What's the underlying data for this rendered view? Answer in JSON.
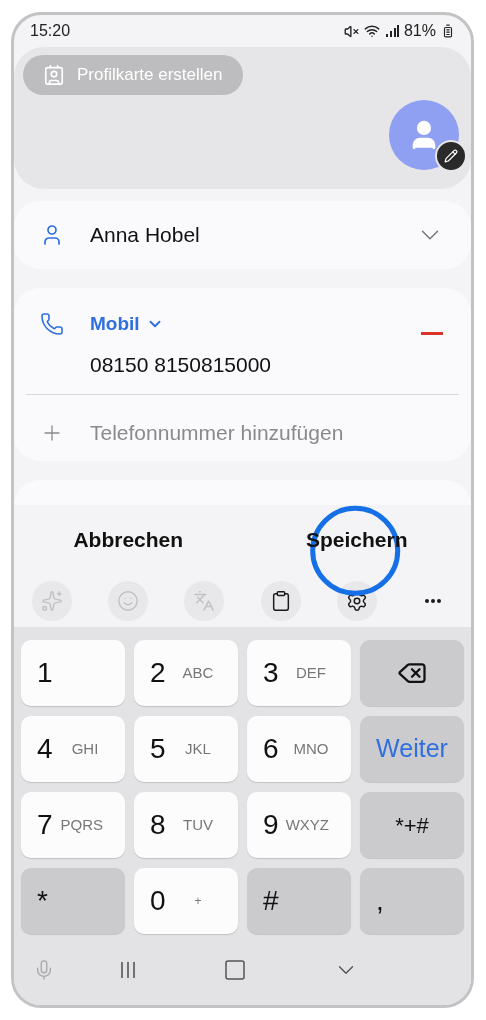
{
  "status_bar": {
    "time": "15:20",
    "battery": "81%"
  },
  "header": {
    "profile_card_button": "Profilkarte erstellen"
  },
  "name_field": {
    "value": "Anna Hobel",
    "expanded": false
  },
  "phone": {
    "type_label": "Mobil",
    "number": "08150 8150815000",
    "add_label": "Telefonnummer hinzufügen"
  },
  "actions": [
    {
      "label": "Abbrechen"
    },
    {
      "label": "Speichern",
      "highlighted": true
    }
  ],
  "toolbar": [
    {
      "kind": "sparkle",
      "disabled": true
    },
    {
      "kind": "emoji",
      "disabled": true
    },
    {
      "kind": "translate",
      "disabled": true
    },
    {
      "kind": "clipboard",
      "disabled": false
    },
    {
      "kind": "settings",
      "disabled": false
    },
    {
      "kind": "more",
      "disabled": false
    }
  ],
  "keyboard": [
    [
      {
        "kind": "digit",
        "label": "1"
      },
      {
        "kind": "digit",
        "label": "2",
        "sub": "ABC"
      },
      {
        "kind": "digit",
        "label": "3",
        "sub": "DEF"
      },
      {
        "kind": "backspace"
      }
    ],
    [
      {
        "kind": "digit",
        "label": "4",
        "sub": "GHI"
      },
      {
        "kind": "digit",
        "label": "5",
        "sub": "JKL"
      },
      {
        "kind": "digit",
        "label": "6",
        "sub": "MNO"
      },
      {
        "kind": "action",
        "label": "Weiter"
      }
    ],
    [
      {
        "kind": "digit",
        "label": "7",
        "sub": "PQRS"
      },
      {
        "kind": "digit",
        "label": "8",
        "sub": "TUV"
      },
      {
        "kind": "digit",
        "label": "9",
        "sub": "WXYZ"
      },
      {
        "kind": "function",
        "label": "*+#"
      }
    ],
    [
      {
        "kind": "function",
        "label": "*"
      },
      {
        "kind": "digit",
        "label": "0",
        "sub": "+"
      },
      {
        "kind": "function",
        "label": "#"
      },
      {
        "kind": "function",
        "label": ","
      }
    ]
  ]
}
